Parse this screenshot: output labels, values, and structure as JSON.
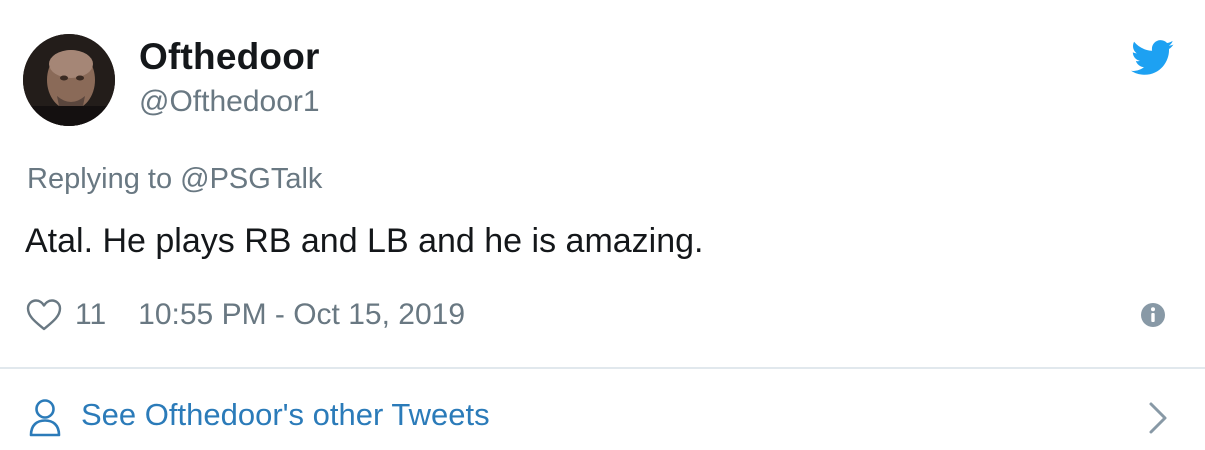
{
  "tweet": {
    "author": {
      "display_name": "Ofthedoor",
      "handle": "@Ofthedoor1",
      "avatar_icon": "avatar-photo"
    },
    "reply_line": "Replying to @PSGTalk",
    "text": "Atal. He plays RB and LB and he is amazing.",
    "likes": "11",
    "timestamp": "10:55 PM - Oct 15, 2019",
    "footer_link": "See Ofthedoor's other Tweets"
  },
  "icons": {
    "brand": "twitter-bird-icon",
    "like": "heart-icon",
    "info": "info-icon",
    "person": "person-icon",
    "chevron": "chevron-right-icon"
  },
  "colors": {
    "brand_blue": "#1da1f2",
    "link_blue": "#2b7bb9",
    "secondary_text": "#697882",
    "primary_text": "#14171a",
    "divider": "#e1e8ed"
  }
}
